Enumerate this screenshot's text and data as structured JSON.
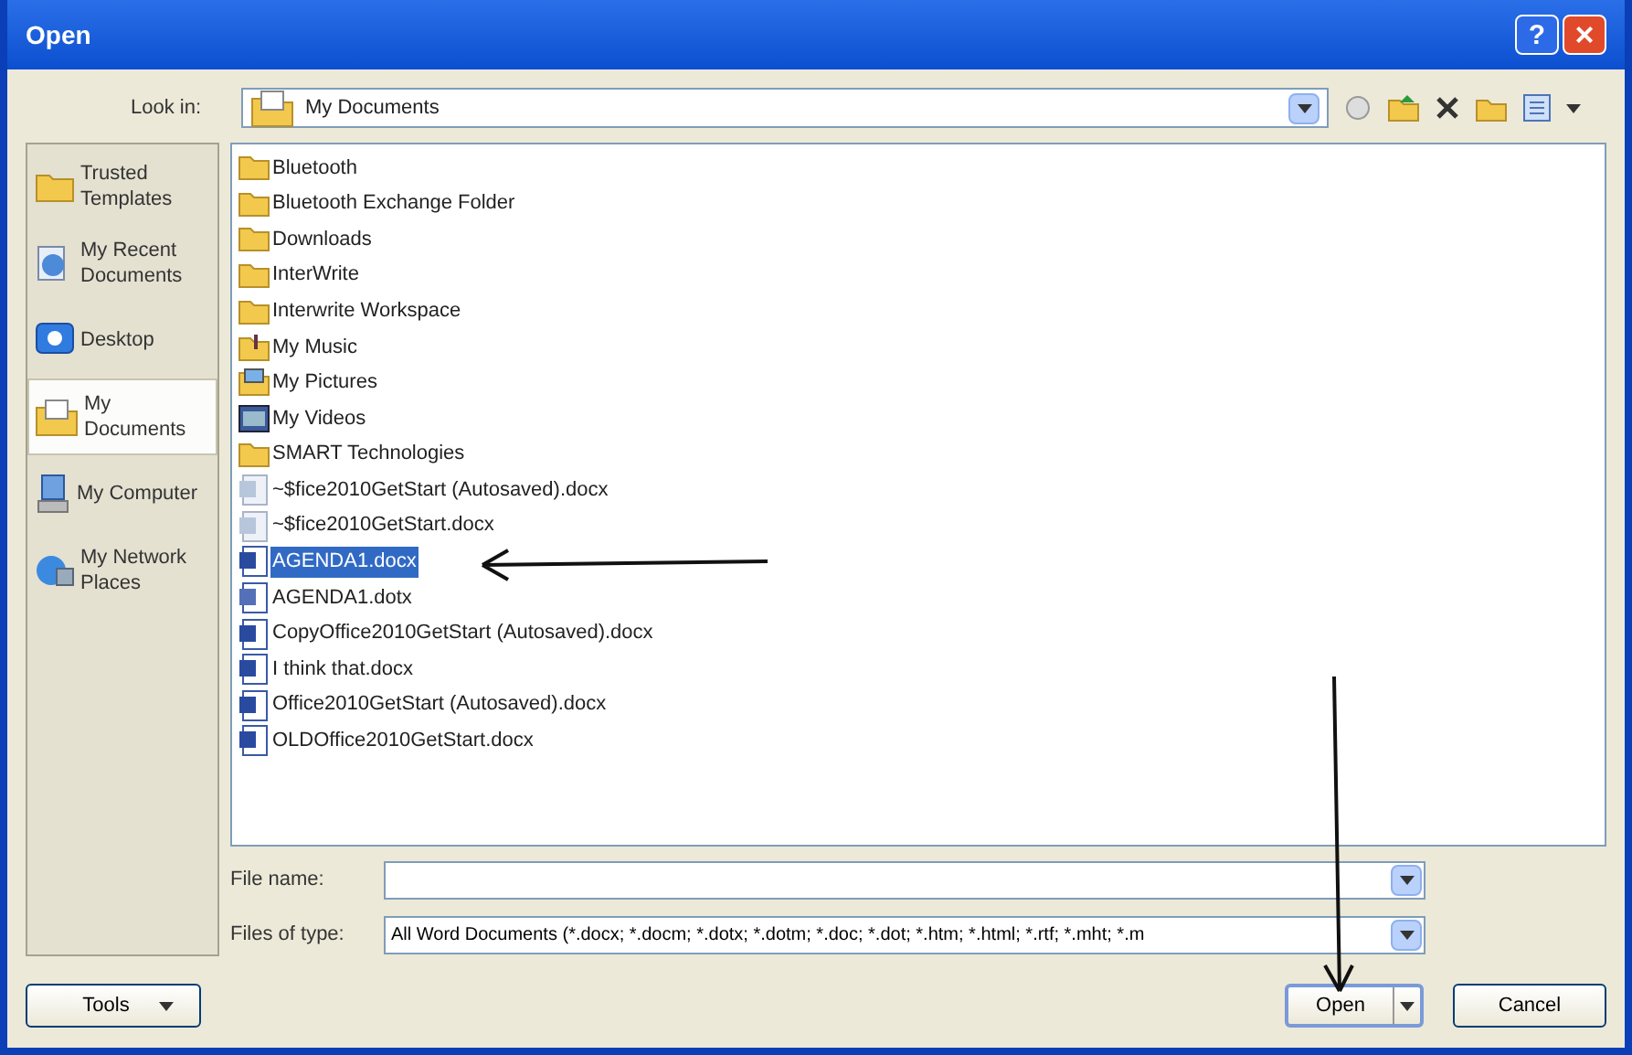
{
  "window": {
    "title": "Open",
    "help": "?",
    "close": "×"
  },
  "look_in": {
    "label": "Look in:",
    "value": "My Documents"
  },
  "places": [
    {
      "label": "Trusted Templates",
      "kind": "folder",
      "selected": false
    },
    {
      "label": "My Recent Documents",
      "kind": "recent",
      "selected": false
    },
    {
      "label": "Desktop",
      "kind": "desktop",
      "selected": false
    },
    {
      "label": "My Documents",
      "kind": "documents",
      "selected": true
    },
    {
      "label": "My Computer",
      "kind": "computer",
      "selected": false
    },
    {
      "label": "My Network Places",
      "kind": "network",
      "selected": false
    }
  ],
  "files": [
    {
      "name": "Bluetooth",
      "kind": "folder",
      "selected": false
    },
    {
      "name": "Bluetooth Exchange Folder",
      "kind": "folder",
      "selected": false
    },
    {
      "name": "Downloads",
      "kind": "folder",
      "selected": false
    },
    {
      "name": "InterWrite",
      "kind": "folder",
      "selected": false
    },
    {
      "name": "Interwrite Workspace",
      "kind": "folder",
      "selected": false
    },
    {
      "name": "My Music",
      "kind": "music",
      "selected": false
    },
    {
      "name": "My Pictures",
      "kind": "pictures",
      "selected": false
    },
    {
      "name": "My Videos",
      "kind": "videos",
      "selected": false
    },
    {
      "name": "SMART Technologies",
      "kind": "folder",
      "selected": false
    },
    {
      "name": "~$fice2010GetStart (Autosaved).docx",
      "kind": "temp",
      "selected": false
    },
    {
      "name": "~$fice2010GetStart.docx",
      "kind": "temp",
      "selected": false
    },
    {
      "name": "AGENDA1.docx",
      "kind": "doc",
      "selected": true
    },
    {
      "name": "AGENDA1.dotx",
      "kind": "template",
      "selected": false
    },
    {
      "name": "CopyOffice2010GetStart (Autosaved).docx",
      "kind": "doc",
      "selected": false
    },
    {
      "name": "I think that.docx",
      "kind": "doc",
      "selected": false
    },
    {
      "name": "Office2010GetStart (Autosaved).docx",
      "kind": "doc",
      "selected": false
    },
    {
      "name": "OLDOffice2010GetStart.docx",
      "kind": "doc",
      "selected": false
    }
  ],
  "file_name": {
    "label": "File name:"
  },
  "files_of_type": {
    "label": "Files of type:",
    "value": "All Word Documents (*.docx; *.docm; *.dotx; *.dotm; *.doc; *.dot; *.htm; *.html; *.rtf; *.mht; *.m"
  },
  "buttons": {
    "tools": "Tools",
    "open": "Open",
    "cancel": "Cancel"
  }
}
